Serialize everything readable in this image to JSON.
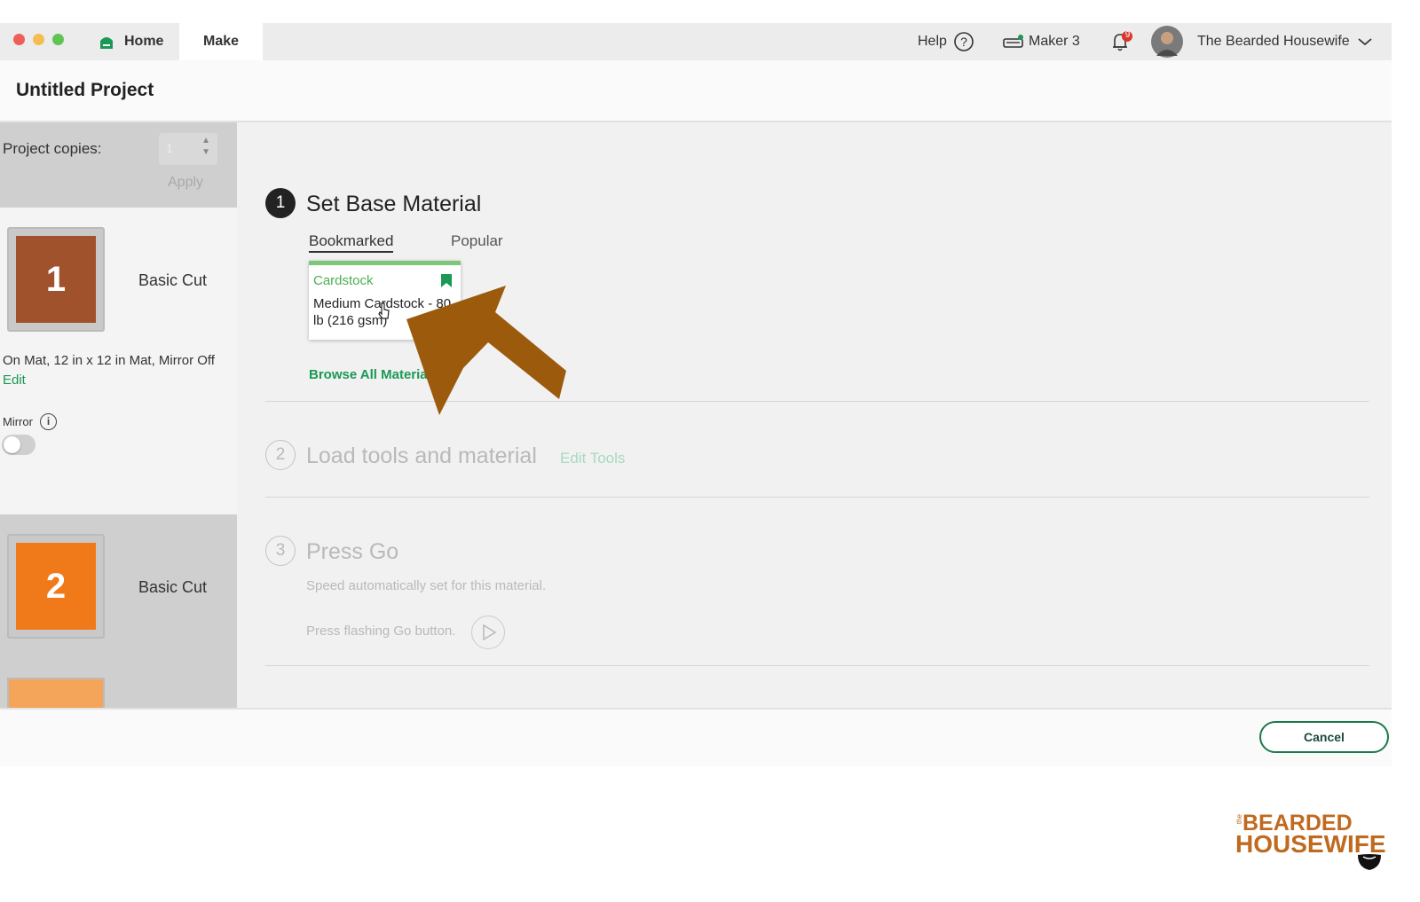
{
  "window": {
    "tabs": {
      "home": "Home",
      "make": "Make"
    },
    "help_label": "Help",
    "machine_label": "Maker 3",
    "notification_count": "9",
    "user_name": "The Bearded Housewife"
  },
  "project": {
    "title": "Untitled Project"
  },
  "sidebar": {
    "copies_label": "Project copies:",
    "copies_value": "1",
    "apply_label": "Apply",
    "mats": [
      {
        "number": "1",
        "label": "Basic Cut",
        "color": "#a0522d"
      },
      {
        "number": "2",
        "label": "Basic Cut",
        "color": "#f07a1a"
      }
    ],
    "mat_settings": "On Mat, 12 in x 12 in Mat, Mirror Off",
    "edit_label": "Edit",
    "mirror_label": "Mirror",
    "mirror_on": false
  },
  "steps": {
    "step1": {
      "number": "1",
      "title": "Set Base Material",
      "tabs": {
        "bookmarked": "Bookmarked",
        "popular": "Popular"
      },
      "card": {
        "category": "Cardstock",
        "name": "Medium Cardstock - 80 lb (216 gsm)"
      },
      "browse_label": "Browse All Materials"
    },
    "step2": {
      "number": "2",
      "title": "Load tools and material",
      "edit_tools": "Edit Tools"
    },
    "step3": {
      "number": "3",
      "title": "Press Go",
      "speed_note": "Speed automatically set for this material.",
      "press_note": "Press flashing Go button."
    }
  },
  "footer": {
    "cancel_label": "Cancel"
  },
  "logo": {
    "small": "the",
    "line1": "BEARDED",
    "line2": "HOUSEWIFE"
  },
  "colors": {
    "accent_green": "#1a9955",
    "arrow": "#9c5a0c"
  }
}
